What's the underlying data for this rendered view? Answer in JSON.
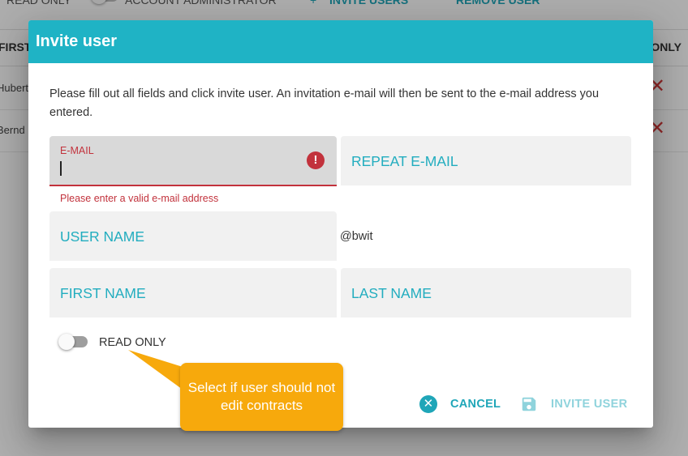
{
  "background": {
    "toolbar": {
      "read_only_label": "READ ONLY",
      "account_admin_label": "ACCOUNT ADMINISTRATOR",
      "invite_users_label": "INVITE USERS",
      "remove_user_label": "REMOVE USER"
    },
    "table": {
      "col_first": "FIRST",
      "col_readonly": "ONLY",
      "rows": [
        {
          "name": "Hubert"
        },
        {
          "name": "Bernd"
        }
      ]
    }
  },
  "dialog": {
    "title": "Invite user",
    "intro": "Please fill out all fields and click invite user. An invitation e-mail will then be sent to the e-mail address you entered.",
    "email": {
      "label": "E-MAIL",
      "value": "",
      "error": "Please enter a valid e-mail address"
    },
    "repeat_email": {
      "label": "REPEAT E-MAIL"
    },
    "user_name": {
      "label": "USER NAME",
      "suffix": "@bwit"
    },
    "first_name": {
      "label": "FIRST NAME"
    },
    "last_name": {
      "label": "LAST NAME"
    },
    "read_only": {
      "label": "READ ONLY",
      "checked": false
    },
    "actions": {
      "cancel_label": "CANCEL",
      "invite_label": "INVITE USER"
    }
  },
  "tooltip": {
    "text": "Select if user should not edit contracts"
  },
  "colors": {
    "accent": "#1fb3c5",
    "error": "#c2323c",
    "tooltip": "#f7a90c"
  },
  "icons": {
    "email_error": "error-icon",
    "cancel": "cancel-circle-icon",
    "invite": "save-icon",
    "row_remove": "close-icon"
  }
}
